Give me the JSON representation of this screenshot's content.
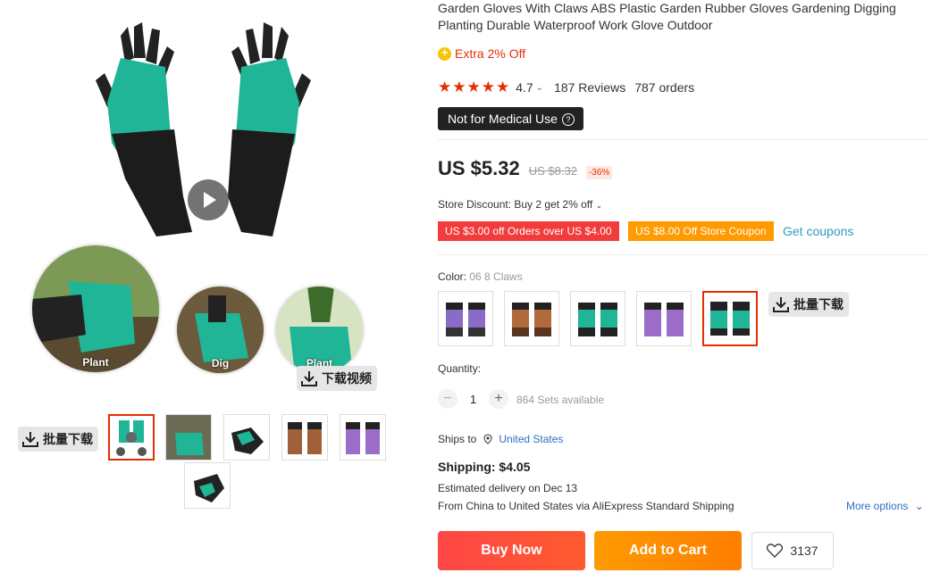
{
  "gallery": {
    "circle_labels": [
      "Plant",
      "Dig",
      "Plant"
    ],
    "download_video_label": "下载视频",
    "batch_download_label": "批量下载"
  },
  "product": {
    "title": "Garden Gloves With Claws ABS Plastic Garden Rubber Gloves Gardening Digging Planting Durable Waterproof Work Glove Outdoor",
    "extra_off": "Extra 2% Off",
    "rating": "4.7",
    "reviews": "187 Reviews",
    "orders": "787 orders",
    "medical_badge": "Not for Medical Use",
    "price": "US $5.32",
    "old_price": "US $8.32",
    "discount_pct": "-36%",
    "store_discount": "Store Discount: Buy 2 get 2% off",
    "coupons": [
      "US $3.00 off Orders over US $4.00",
      "US $8.00 Off Store Coupon"
    ],
    "get_coupons": "Get coupons",
    "color_label": "Color:",
    "color_value": "06 8 Claws",
    "batch_download_label": "批量下载",
    "quantity_label": "Quantity:",
    "quantity": "1",
    "available": "864 Sets available",
    "ships_to_label": "Ships to",
    "ships_to_country": "United States",
    "shipping": "Shipping: $4.05",
    "estimated_delivery": "Estimated delivery on Dec 13",
    "from_line": "From China to United States via AliExpress Standard Shipping",
    "more_options": "More options",
    "buy_now": "Buy Now",
    "add_to_cart": "Add to Cart",
    "wishlist_count": "3137"
  },
  "colors": {
    "accent": "#e62e04",
    "teal": "#1fb596",
    "buy_gradient": [
      "#ff4747",
      "#ff7e00"
    ],
    "link": "#2e6fbf"
  }
}
